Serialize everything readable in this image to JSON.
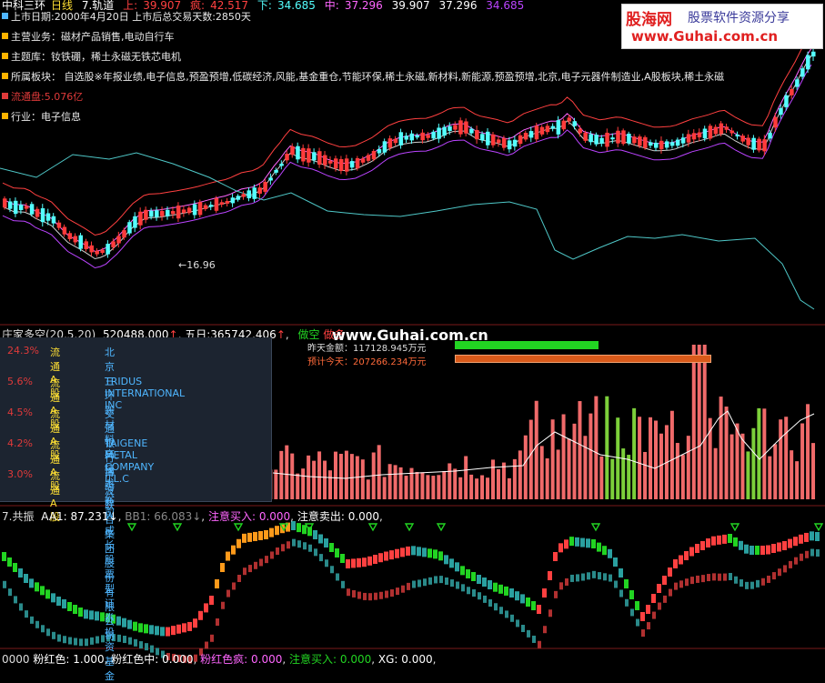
{
  "header": {
    "title": "中科三环",
    "period": "日线",
    "indicator": "7.轨道",
    "upper_label": "上:",
    "upper_value": "39.907",
    "crazy_label": "疯:",
    "crazy_value": "42.517",
    "lower_label": "下:",
    "lower_value": "34.685",
    "mid_label": "中:",
    "mid_value": "37.296",
    "v1": "39.907",
    "v2": "37.296",
    "v3": "34.685"
  },
  "logo": {
    "brand": "股海网",
    "slogan": "股票软件资源分享",
    "url": "www.Guhai.com.cn"
  },
  "info_lines": [
    {
      "text": "上市日期:2000年4月20日 上市后总交易天数:2850天",
      "color": "#4fb6ff"
    },
    {
      "text": "主营业务：磁材产品销售,电动自行车",
      "color": "#ffb400"
    },
    {
      "text": "主题库：钕铁硼，稀土永磁无铁芯电机",
      "color": "#ffb400"
    },
    {
      "text": "所属板块： 自选股※年报业绩,电子信息,预盈预增,低碳经济,风能,基金重仓,节能环保,稀土永磁,新材料,新能源,预盈预增,北京,电子元器件制造业,A股板块,稀土永磁",
      "color": "#ffb400"
    },
    {
      "text": "流通盘:5.076亿",
      "color": "#e03a3a",
      "red": true
    },
    {
      "text": "行业：电子信息",
      "color": "#ffb400"
    }
  ],
  "low_marker": "16.96",
  "panel2": {
    "title": "庄家多空(20,5,20)",
    "v1": "520488.000",
    "v1_label": "五日:",
    "v2": "365742.406",
    "tag1": "做空",
    "tag2": "做多",
    "watermark": "www.Guhai.com.cn",
    "yesterday_label": "昨天金额：117128.945万元",
    "today_label": "预计今天：207266.234万元",
    "yesterday_frac": 0.56,
    "today_frac": 1.0,
    "colors": {
      "yesterday": "#22d422",
      "today": "#d95a1a"
    }
  },
  "holders": [
    {
      "pct": "24.3%",
      "type": "流通A股",
      "name": "北京三环新材料高技术公司"
    },
    {
      "pct": "5.6%",
      "type": "流通A股",
      "name": "TRIDUS INTERNATIONAL INC"
    },
    {
      "pct": "4.5%",
      "type": "流通A股",
      "name": "交通银行-博时新兴成长股票型证券投资基金"
    },
    {
      "pct": "4.2%",
      "type": "流通A股",
      "name": "TAIGENE METAL COMPANY L.L.C"
    },
    {
      "pct": "3.0%",
      "type": "流通A股",
      "name": "宁波联合集团股份有限公司"
    }
  ],
  "panel3": {
    "title": "7.共振",
    "aa1_label": "AA1:",
    "aa1_value": "87.231",
    "bb1_label": "BB1:",
    "bb1_value": "66.083",
    "buy_label": "注意买入:",
    "buy_value": "0.000",
    "sell_label": "注意卖出:",
    "sell_value": "0.000"
  },
  "bottom": {
    "prefix": "0000",
    "pink_label": "粉红色:",
    "pink_value": "1.000",
    "pinkmid_label": "粉红色中:",
    "pinkmid_value": "0.000",
    "pinkcrazy_label": "粉红色疯:",
    "pinkcrazy_value": "0.000",
    "buy_label": "注意买入:",
    "buy_value": "0.000",
    "xg_label": "XG:",
    "xg_value": "0.000"
  },
  "colors": {
    "up": "#ff3b3b",
    "down": "#54ffff",
    "upper_band": "#ff4040",
    "mid_band": "#ff66ff",
    "lower_band": "#bb44ff",
    "cyan_line": "#4fc8c8",
    "green": "#22d422",
    "orange": "#ff9a1a"
  }
}
